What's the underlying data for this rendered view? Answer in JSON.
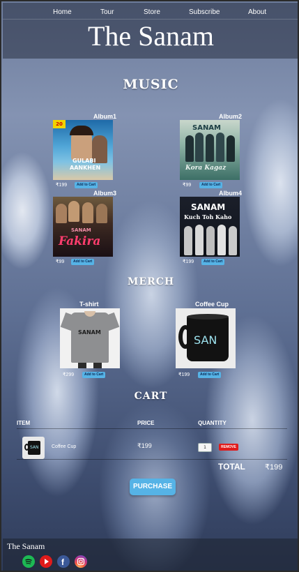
{
  "nav": {
    "items": [
      "Home",
      "Tour",
      "Store",
      "Subscribe",
      "About"
    ]
  },
  "site": {
    "title": "The Sanam"
  },
  "music": {
    "heading": "MUSIC",
    "albums": [
      {
        "name": "Album1",
        "price": "₹199",
        "button": "Add to Cart",
        "cover_text_1": "GULABI",
        "cover_text_2": "AANKHEN",
        "cover_tag": "20"
      },
      {
        "name": "Album2",
        "price": "₹99",
        "button": "Add to Cart",
        "cover_text_1": "SANAM",
        "cover_text_2": "Kora Kagaz"
      },
      {
        "name": "Album3",
        "price": "₹99",
        "button": "Add to Cart",
        "cover_text_1": "SANAM",
        "cover_text_2": "Fakira"
      },
      {
        "name": "Album4",
        "price": "₹199",
        "button": "Add to Cart",
        "cover_text_1": "SANAM",
        "cover_text_2": "Kuch Toh Kaho"
      }
    ]
  },
  "merch": {
    "heading": "MERCH",
    "items": [
      {
        "name": "T-shirt",
        "price": "₹299",
        "button": "Add to Cart",
        "print_text": "SANAM"
      },
      {
        "name": "Coffee Cup",
        "price": "₹199",
        "button": "Add to Cart",
        "print_text": "SAN"
      }
    ]
  },
  "cart": {
    "heading": "CART",
    "columns": [
      "ITEM",
      "PRICE",
      "QUANTITY"
    ],
    "rows": [
      {
        "item": "Coffee Cup",
        "price": "₹199",
        "quantity": "1",
        "remove": "REMOVE"
      }
    ],
    "total_label": "TOTAL",
    "total_value": "₹199",
    "purchase": "PURCHASE"
  },
  "footer": {
    "title": "The Sanam",
    "social_icons": [
      "spotify-icon",
      "youtube-icon",
      "facebook-icon",
      "instagram-icon"
    ]
  },
  "colors": {
    "accent_button": "#56b3e6",
    "remove_button": "#e01b1b"
  }
}
